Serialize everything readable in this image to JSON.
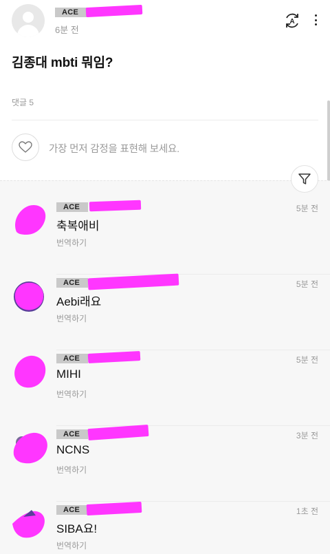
{
  "post": {
    "author_badge": "ACE",
    "time": "6분 전",
    "title": "김종대 mbti 뭐임?",
    "comment_count": "댓글 5",
    "react_placeholder": "가장 먼저 감정을 표현해 보세요."
  },
  "icons": {
    "translate": "translate-icon",
    "more": "more-vertical-icon",
    "heart": "heart-icon",
    "filter": "filter-icon",
    "avatar": "avatar-placeholder-icon"
  },
  "colors": {
    "redaction": "#ff36ff",
    "badge_bg": "#c9c9c9",
    "comments_bg": "#f7f7f7"
  },
  "comments": [
    {
      "badge": "ACE",
      "text": "축복애비",
      "time": "5분 전",
      "translate": "번역하기"
    },
    {
      "badge": "ACE",
      "text": "Aebi래요",
      "time": "5분 전",
      "translate": "번역하기"
    },
    {
      "badge": "ACE",
      "text": "MIHI",
      "time": "5분 전",
      "translate": "번역하기"
    },
    {
      "badge": "ACE",
      "text": "NCNS",
      "time": "3분 전",
      "translate": "번역하기"
    },
    {
      "badge": "ACE",
      "text": "SIBA요!",
      "time": "1초 전",
      "translate": "번역하기"
    }
  ]
}
